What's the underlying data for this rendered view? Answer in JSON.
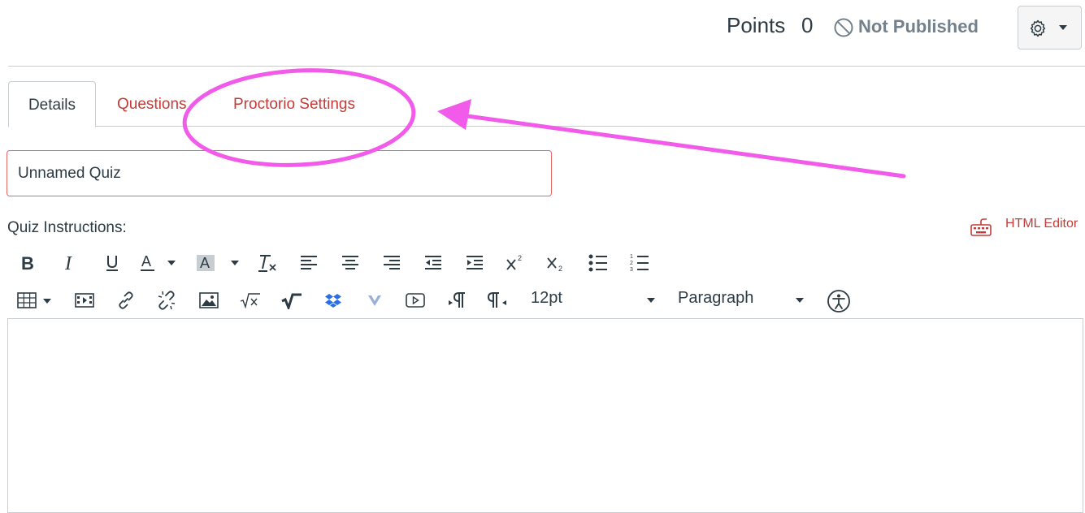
{
  "header": {
    "points_label": "Points",
    "points_value": "0",
    "publish_status": "Not Published",
    "settings_icon": "gear-icon"
  },
  "tabs": [
    {
      "label": "Details",
      "active": true
    },
    {
      "label": "Questions",
      "active": false
    },
    {
      "label": "Proctorio Settings",
      "active": false
    }
  ],
  "quiz": {
    "title_value": "Unnamed Quiz",
    "instructions_label": "Quiz Instructions:"
  },
  "editor": {
    "html_editor_label": "HTML Editor",
    "font_size": "12pt",
    "block_format": "Paragraph"
  },
  "colors": {
    "link": "#c43c37",
    "annotation": "#f25ae9"
  }
}
